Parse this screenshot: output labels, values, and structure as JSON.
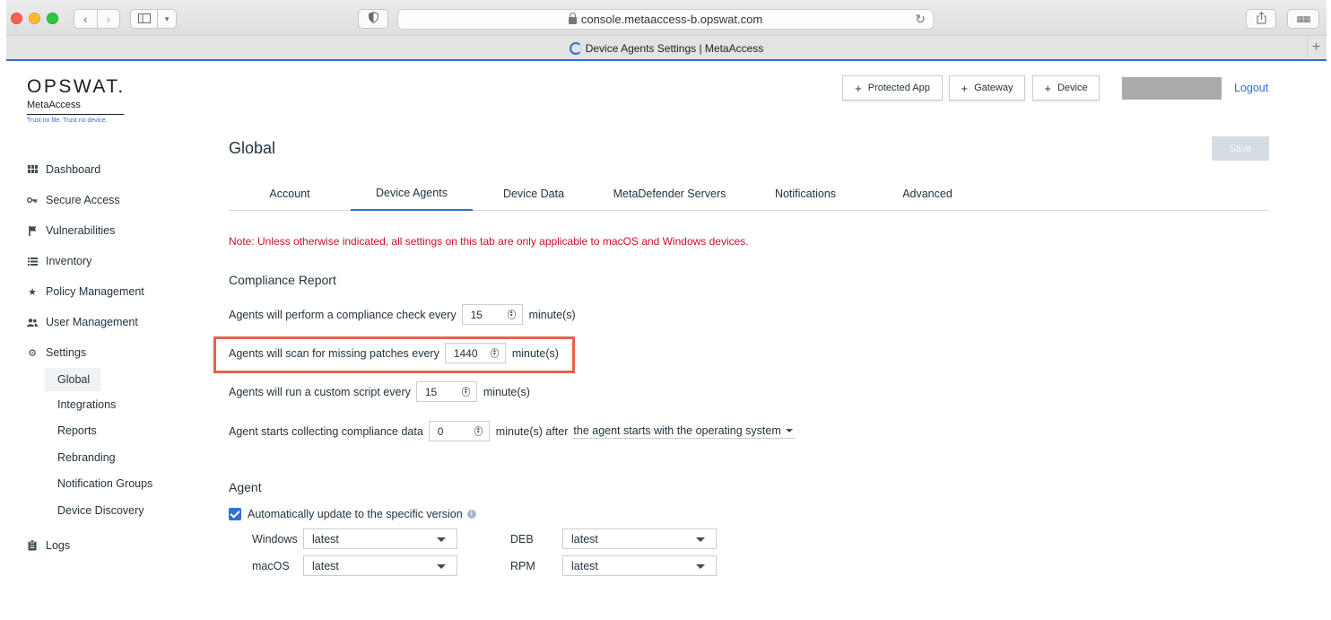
{
  "browser": {
    "url": "console.metaaccess-b.opswat.com",
    "tab_title": "Device Agents Settings | MetaAccess"
  },
  "logo": {
    "brand": "OPSWAT.",
    "product": "MetaAccess",
    "tagline": "Trust no file. Trust no device."
  },
  "sidebar": {
    "items": [
      {
        "label": "Dashboard",
        "icon": "grid-icon"
      },
      {
        "label": "Secure Access",
        "icon": "key-icon"
      },
      {
        "label": "Vulnerabilities",
        "icon": "flag-icon"
      },
      {
        "label": "Inventory",
        "icon": "list-icon"
      },
      {
        "label": "Policy Management",
        "icon": "star-icon"
      },
      {
        "label": "User Management",
        "icon": "users-icon"
      },
      {
        "label": "Settings",
        "icon": "gear-icon"
      }
    ],
    "settings_sub": [
      "Global",
      "Integrations",
      "Reports",
      "Rebranding",
      "Notification Groups",
      "Device Discovery"
    ],
    "logs": {
      "label": "Logs",
      "icon": "clipboard-icon"
    }
  },
  "header": {
    "buttons": [
      "Protected App",
      "Gateway",
      "Device"
    ],
    "logout": "Logout"
  },
  "page": {
    "title": "Global",
    "save": "Save",
    "tabs": [
      "Account",
      "Device Agents",
      "Device Data",
      "MetaDefender Servers",
      "Notifications",
      "Advanced"
    ],
    "active_tab": "Device Agents",
    "note": "Note: Unless otherwise indicated, all settings on this tab are only applicable to macOS and Windows devices."
  },
  "compliance": {
    "heading": "Compliance Report",
    "check": {
      "label": "Agents will perform a compliance check every",
      "value": "15",
      "unit": "minute(s)"
    },
    "patches": {
      "label": "Agents will scan for missing patches every",
      "value": "1440",
      "unit": "minute(s)"
    },
    "script": {
      "label": "Agents will run a custom script every",
      "value": "15",
      "unit": "minute(s)"
    },
    "collect": {
      "label": "Agent starts collecting compliance data",
      "value": "0",
      "unit": "minute(s) after",
      "when": "the agent starts with the operating system"
    }
  },
  "agent": {
    "heading": "Agent",
    "auto_update": "Automatically update to the specific version",
    "auto_update_checked": true,
    "versions": [
      {
        "os": "Windows",
        "value": "latest"
      },
      {
        "os": "macOS",
        "value": "latest"
      },
      {
        "os": "DEB",
        "value": "latest"
      },
      {
        "os": "RPM",
        "value": "latest"
      }
    ]
  },
  "colors": {
    "accent": "#2f6fd6",
    "note": "#c8102e",
    "highlight": "#e8604b"
  }
}
